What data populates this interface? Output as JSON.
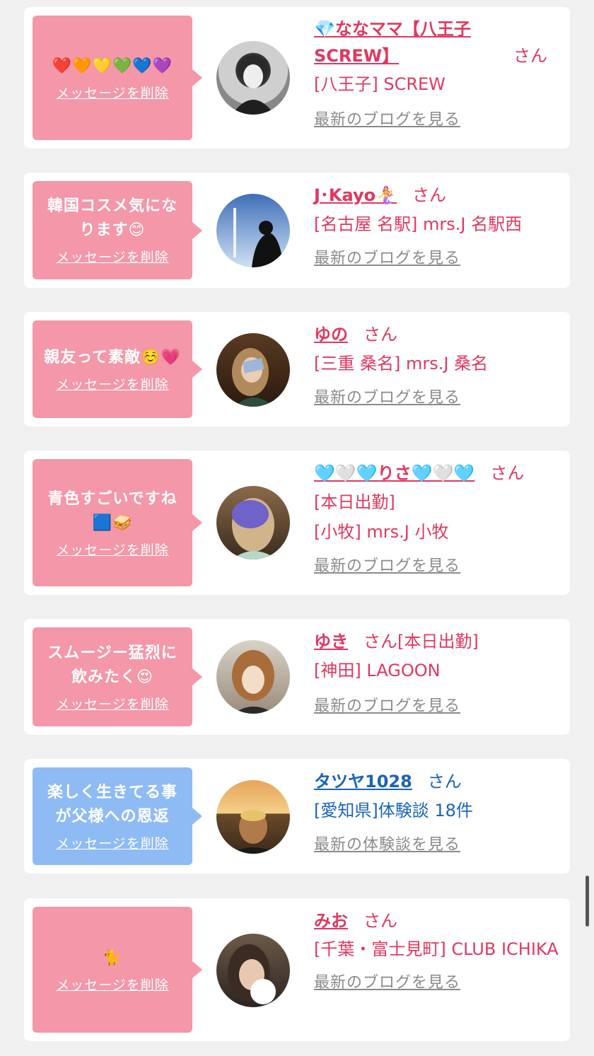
{
  "delete_label": "メッセージを削除",
  "san": "さん",
  "cards": [
    {
      "message": "❤️🧡💛💚💙💜",
      "name": "💎ななママ【八王子SCREW】",
      "meta": [
        "[八王子] SCREW"
      ],
      "more": "最新のブログを見る"
    },
    {
      "message": "韓国コスメ気になります😊",
      "name": "J･Kayo🧜‍♀️",
      "meta": [
        "[名古屋 名駅] mrs.J 名駅西"
      ],
      "more": "最新のブログを見る"
    },
    {
      "message": "親友って素敵☺️💗",
      "name": "ゆの",
      "meta": [
        "[三重 桑名] mrs.J 桑名"
      ],
      "more": "最新のブログを見る"
    },
    {
      "message": "青色すごいですね🟦🥪",
      "name": "🩵🤍🩵りさ🩵🤍🩵",
      "meta": [
        "[本日出勤]",
        "[小牧] mrs.J 小牧"
      ],
      "more": "最新のブログを見る"
    },
    {
      "message": "スムージー猛烈に飲みたく😍",
      "name": "ゆき",
      "name_suffix": "[本日出勤]",
      "meta": [
        "[神田] LAGOON"
      ],
      "more": "最新のブログを見る"
    },
    {
      "message": "楽しく生きてる事が父様への恩返",
      "name": "タツヤ1028",
      "meta": [
        "[愛知県]体験談 18件"
      ],
      "more": "最新の体験談を見る"
    },
    {
      "message": "🐈",
      "name": "みお",
      "meta": [
        "[千葉・富士見町] CLUB ICHIKA"
      ],
      "more": "最新のブログを見る"
    }
  ]
}
